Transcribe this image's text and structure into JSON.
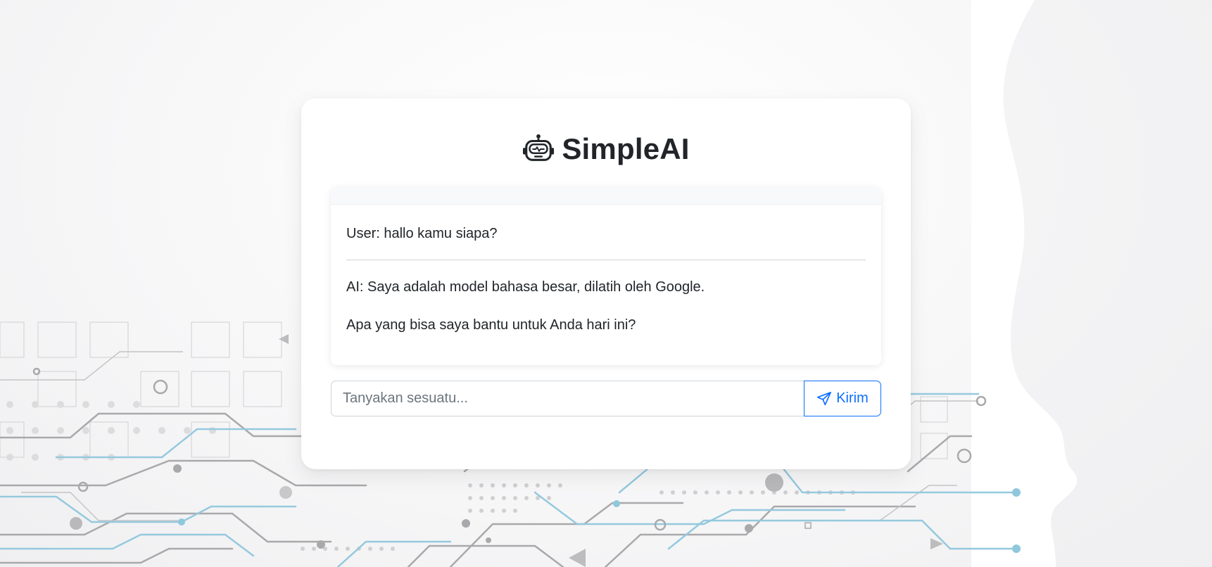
{
  "app": {
    "title": "SimpleAI",
    "logo_icon": "robot-icon"
  },
  "chat": {
    "messages": [
      {
        "role": "user",
        "text": "User: hallo kamu siapa?"
      },
      {
        "role": "ai",
        "paragraphs": [
          "AI: Saya adalah model bahasa besar, dilatih oleh Google.",
          "Apa yang bisa saya bantu untuk Anda hari ini?"
        ]
      }
    ]
  },
  "input": {
    "placeholder": "Tanyakan sesuatu...",
    "value": ""
  },
  "send_button": {
    "label": "Kirim",
    "icon": "send-icon"
  },
  "colors": {
    "accent": "#0d6efd",
    "text": "#212529",
    "background_circuit_blue": "#8fc7dc",
    "background_circuit_gray": "#b9b9b9"
  }
}
